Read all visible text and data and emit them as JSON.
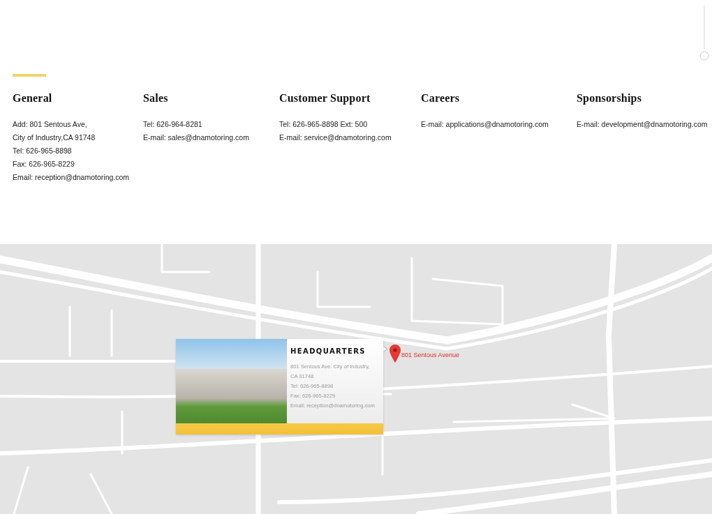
{
  "contact_sections": [
    {
      "heading": "General",
      "lines": [
        "Add: 801 Sentous Ave,",
        "City of Industry,CA 91748",
        "Tel: 626-965-8898",
        "Fax: 626-965-8229",
        "Email: reception@dnamotoring.com"
      ]
    },
    {
      "heading": "Sales",
      "lines": [
        "Tel: 626-964-8281",
        "E-mail: sales@dnamotoring.com"
      ]
    },
    {
      "heading": "Customer Support",
      "lines": [
        "Tel: 626-965-8898 Ext: 500",
        "E-mail: service@dnamotoring.com"
      ]
    },
    {
      "heading": "Careers",
      "lines": [
        "E-mail: applications@dnamotoring.com"
      ]
    },
    {
      "heading": "Sponsorships",
      "lines": [
        "E-mail: development@dnamotoring.com"
      ]
    }
  ],
  "map": {
    "marker": {
      "label": "801 Sentous Avenue"
    },
    "headquarters_card": {
      "title": "HEADQUARTERS",
      "lines": [
        "801 Sentous Ave. City of Industry,",
        "CA 91748",
        "Tel: 626-965-8898",
        "Fax: 626-965-8229",
        "Email: reception@dnamotoring.com"
      ]
    }
  }
}
